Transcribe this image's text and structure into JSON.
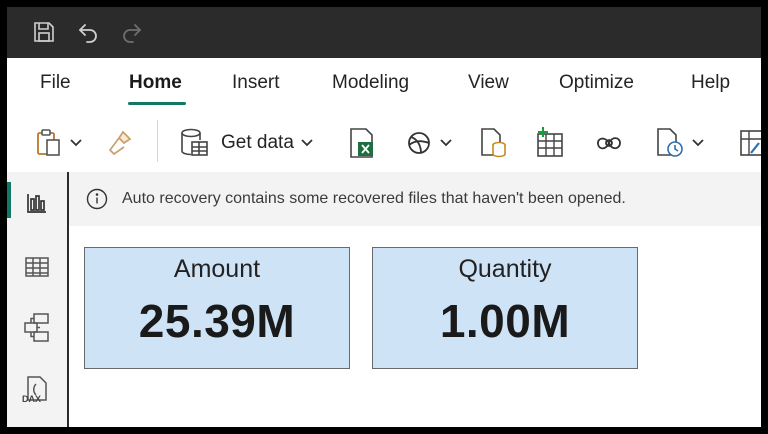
{
  "menu": {
    "items": [
      {
        "label": "File"
      },
      {
        "label": "Home"
      },
      {
        "label": "Insert"
      },
      {
        "label": "Modeling"
      },
      {
        "label": "View"
      },
      {
        "label": "Optimize"
      },
      {
        "label": "Help"
      }
    ],
    "active": "Home"
  },
  "toolbar": {
    "get_data_label": "Get data"
  },
  "infobar": {
    "message": "Auto recovery contains some recovered files that haven't been opened."
  },
  "cards": [
    {
      "label": "Amount",
      "value": "25.39M"
    },
    {
      "label": "Quantity",
      "value": "1.00M"
    }
  ],
  "sidebar": {
    "dax_label": "DAX"
  },
  "colors": {
    "accent": "#117865",
    "card_fill": "#cfe3f7",
    "titlebar": "#2b2b2b",
    "excel_green": "#1d6f42"
  }
}
